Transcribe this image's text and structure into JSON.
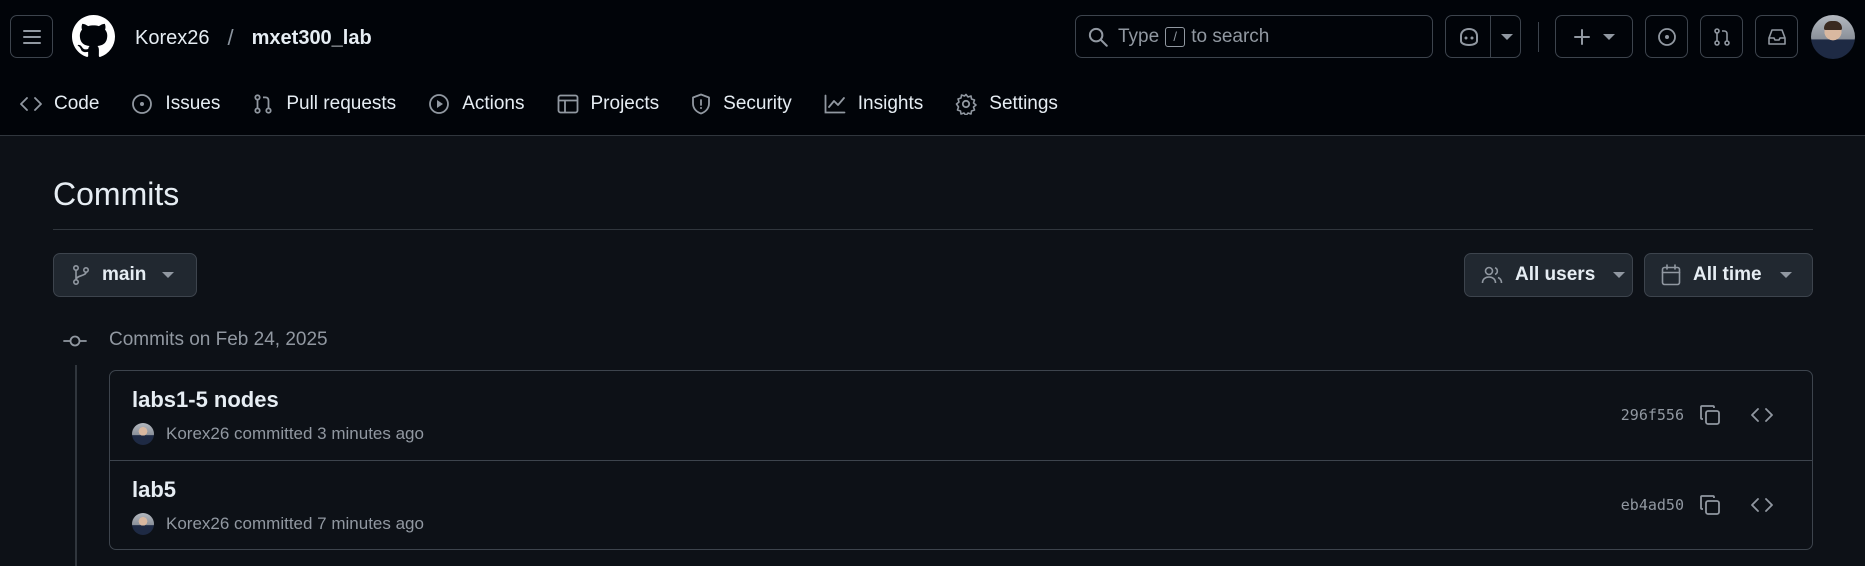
{
  "breadcrumb": {
    "owner": "Korex26",
    "separator": "/",
    "repo": "mxet300_lab"
  },
  "search": {
    "prefix": "Type",
    "key": "/",
    "suffix": "to search"
  },
  "nav": [
    {
      "label": "Code",
      "icon": "code-icon"
    },
    {
      "label": "Issues",
      "icon": "issue-icon"
    },
    {
      "label": "Pull requests",
      "icon": "pull-request-icon"
    },
    {
      "label": "Actions",
      "icon": "play-icon"
    },
    {
      "label": "Projects",
      "icon": "table-icon"
    },
    {
      "label": "Security",
      "icon": "shield-icon"
    },
    {
      "label": "Insights",
      "icon": "graph-icon"
    },
    {
      "label": "Settings",
      "icon": "gear-icon"
    }
  ],
  "page": {
    "title": "Commits"
  },
  "filters": {
    "branch": "main",
    "users": "All users",
    "time": "All time"
  },
  "group": {
    "label": "Commits on Feb 24, 2025"
  },
  "commits": [
    {
      "message": "labs1-5 nodes",
      "meta": "Korex26 committed 3 minutes ago",
      "sha": "296f556"
    },
    {
      "message": "lab5",
      "meta": "Korex26 committed 7 minutes ago",
      "sha": "eb4ad50"
    }
  ],
  "colors": {
    "header_bg": "#010409",
    "page_bg": "#0d1117",
    "border": "#30363d",
    "muted": "#9198a1",
    "text": "#e6edf3"
  }
}
